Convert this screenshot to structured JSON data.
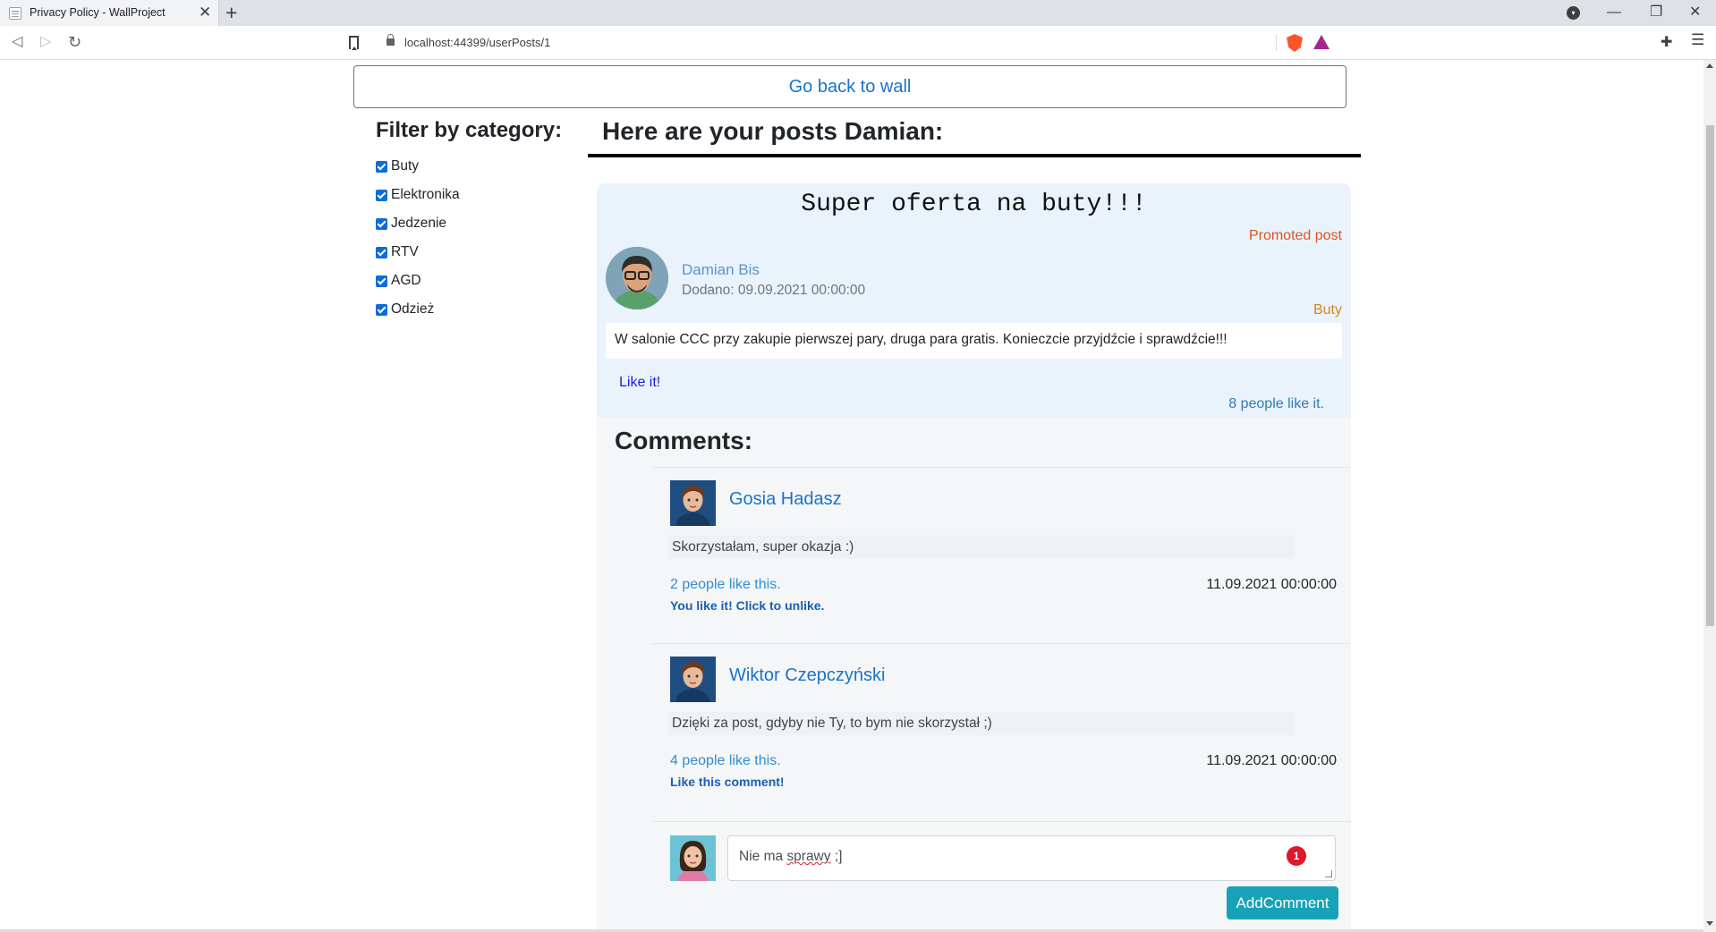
{
  "browser": {
    "tab_title": "Privacy Policy - WallProject",
    "tab_close": "✕",
    "new_tab": "+",
    "url": "localhost:44399/userPosts/1",
    "controls": {
      "minimize": "—",
      "maximize": "❐",
      "close": "✕"
    },
    "nav": {
      "back": "◁",
      "forward": "▷",
      "reload": "↻"
    }
  },
  "page": {
    "back_button": "Go back to wall",
    "filter": {
      "title": "Filter by category:",
      "categories": [
        {
          "label": "Buty",
          "checked": true
        },
        {
          "label": "Elektronika",
          "checked": true
        },
        {
          "label": "Jedzenie",
          "checked": true
        },
        {
          "label": "RTV",
          "checked": true
        },
        {
          "label": "AGD",
          "checked": true
        },
        {
          "label": "Odzież",
          "checked": true
        }
      ]
    },
    "posts_heading": "Here are your posts Damian:",
    "post": {
      "title": "Super oferta na buty!!!",
      "promoted": "Promoted post",
      "author": "Damian Bis",
      "date": "Dodano: 09.09.2021 00:00:00",
      "category": "Buty",
      "body": "W salonie CCC przy zakupie pierwszej pary, druga para gratis. Konieczcie przyjdźcie i sprawdźcie!!!",
      "like_link": "Like it!",
      "likes": "8 people like it."
    },
    "comments": {
      "title": "Comments:",
      "items": [
        {
          "author": "Gosia Hadasz",
          "text": "Skorzystałam, super okazja :)",
          "likes": "2 people like this.",
          "date": "11.09.2021 00:00:00",
          "action": "You like it! Click to unlike."
        },
        {
          "author": "Wiktor Czepczyński",
          "text": "Dzięki za post, gdyby nie Ty, to bym nie skorzystał ;)",
          "likes": "4 people like this.",
          "date": "11.09.2021 00:00:00",
          "action": "Like this comment!"
        }
      ],
      "new_comment": {
        "value_before": "Nie ma ",
        "value_misspelled": "sprawy",
        "value_after": " ;]",
        "badge": "1",
        "button": "AddComment"
      }
    }
  }
}
